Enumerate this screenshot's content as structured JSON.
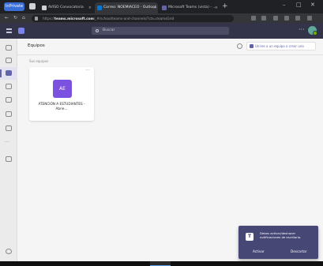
{
  "browser": {
    "profile_label": "InPrivate",
    "tabs": [
      {
        "title": "AVISO Convocatoria",
        "active": false
      },
      {
        "title": "Correo: NOEMIACEO - Outlook",
        "active": true
      },
      {
        "title": "Microsoft Teams (vista) - ...",
        "active": false
      }
    ],
    "new_tab": "+",
    "url_prefix": "https://",
    "url_host": "teams.microsoft.com",
    "url_path": "/_#/school/teams-and-channels/?ctx=teamsGrid",
    "window_controls": {
      "minimize": "–",
      "maximize": "□",
      "close": "✕"
    }
  },
  "teams": {
    "search_placeholder": "Buscar",
    "more_label": "···",
    "page_title": "Equipos",
    "join_button_label": "Unirse a un equipo o crear uno",
    "section_label": "Sus equipos",
    "cards": [
      {
        "initials": "AE",
        "name": "ATENCIÓN A ESTUDIANTES - Abrie..."
      }
    ],
    "card_more": "···",
    "rail_items": [
      {
        "name": "activity"
      },
      {
        "name": "chat"
      },
      {
        "name": "teams",
        "active": true
      },
      {
        "name": "assignments"
      },
      {
        "name": "calendar"
      },
      {
        "name": "calls"
      },
      {
        "name": "files"
      }
    ],
    "rail_more": "···"
  },
  "toast": {
    "message": "Debes activar/deshacer notificaciones de escritorio.",
    "activate_label": "Activar",
    "dismiss_label": "Descartar"
  },
  "colors": {
    "teams_purple": "#6264a7",
    "header_bg": "#33344a",
    "team_avatar": "#7b51e0",
    "toast_bg": "#464775"
  }
}
